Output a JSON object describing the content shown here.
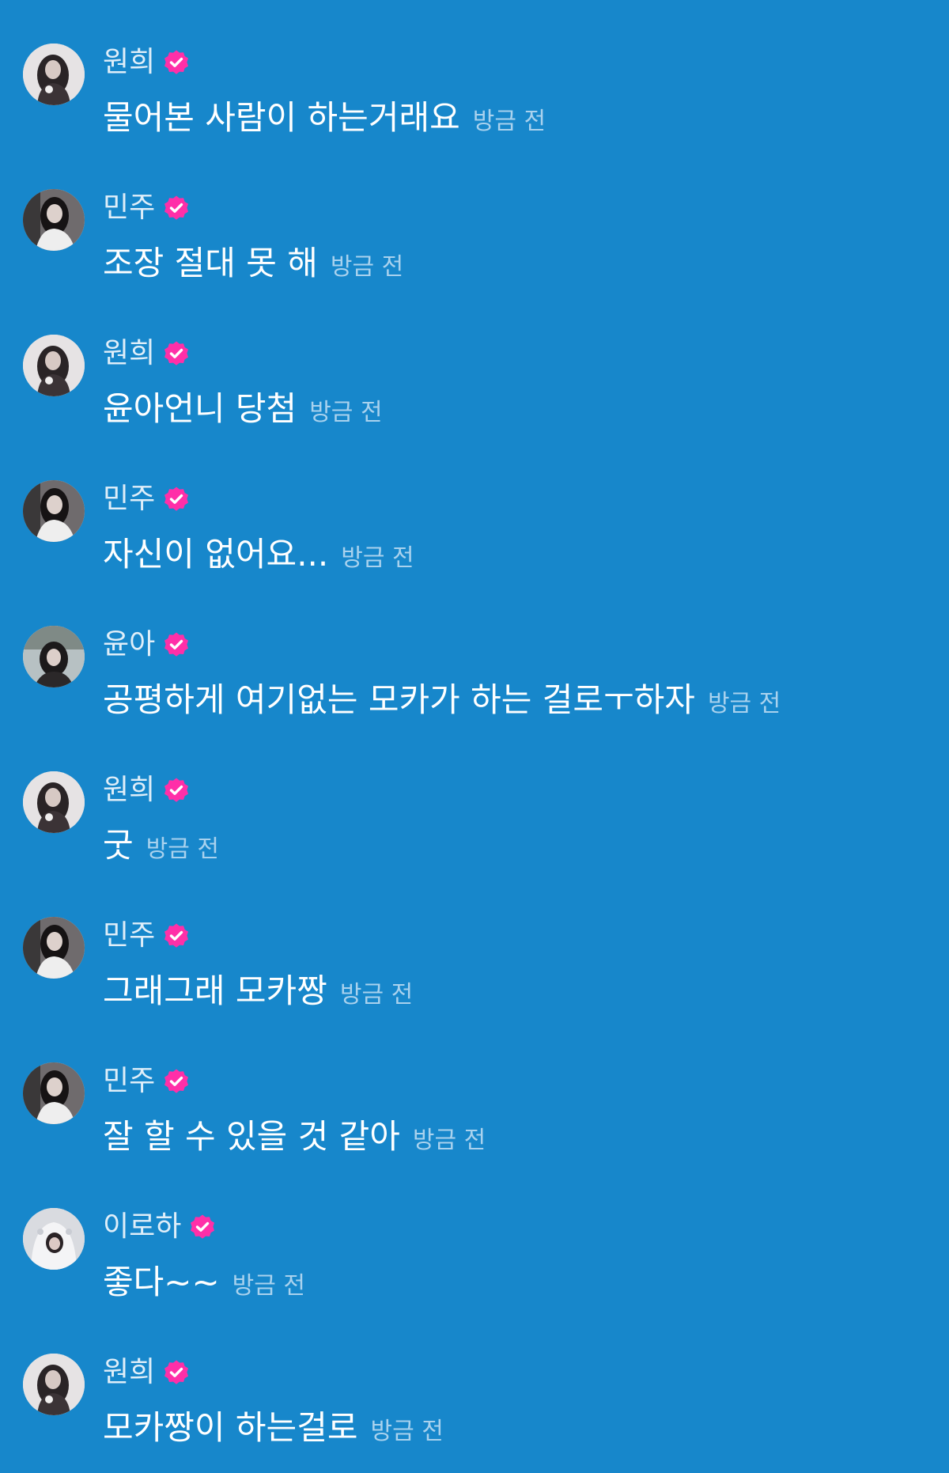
{
  "colors": {
    "background": "#1787cb",
    "badge": "#ff2fa8",
    "name": "#dfeef9",
    "message": "#ffffff",
    "timestamp": "#a9d2ee"
  },
  "messages": [
    {
      "author": "원희",
      "text": "물어본 사람이 하는거래요",
      "time": "방금 전",
      "avatar": "avatar-wonhee",
      "verified": true
    },
    {
      "author": "민주",
      "text": "조장 절대 못 해",
      "time": "방금 전",
      "avatar": "avatar-minju",
      "verified": true
    },
    {
      "author": "원희",
      "text": "윤아언니 당첨",
      "time": "방금 전",
      "avatar": "avatar-wonhee",
      "verified": true
    },
    {
      "author": "민주",
      "text": "자신이 없어요...",
      "time": "방금 전",
      "avatar": "avatar-minju",
      "verified": true
    },
    {
      "author": "윤아",
      "text": "공평하게 여기없는 모카가 하는 걸로ㅜ하자",
      "time": "방금 전",
      "avatar": "avatar-yuna",
      "verified": true
    },
    {
      "author": "원희",
      "text": "굿",
      "time": "방금 전",
      "avatar": "avatar-wonhee",
      "verified": true
    },
    {
      "author": "민주",
      "text": "그래그래 모카짱",
      "time": "방금 전",
      "avatar": "avatar-minju",
      "verified": true
    },
    {
      "author": "민주",
      "text": "잘 할 수 있을 것 같아",
      "time": "방금 전",
      "avatar": "avatar-minju",
      "verified": true
    },
    {
      "author": "이로하",
      "text": "좋다~~",
      "time": "방금 전",
      "avatar": "avatar-iroha",
      "verified": true
    },
    {
      "author": "원희",
      "text": "모카짱이 하는걸로",
      "time": "방금 전",
      "avatar": "avatar-wonhee",
      "verified": true
    }
  ]
}
